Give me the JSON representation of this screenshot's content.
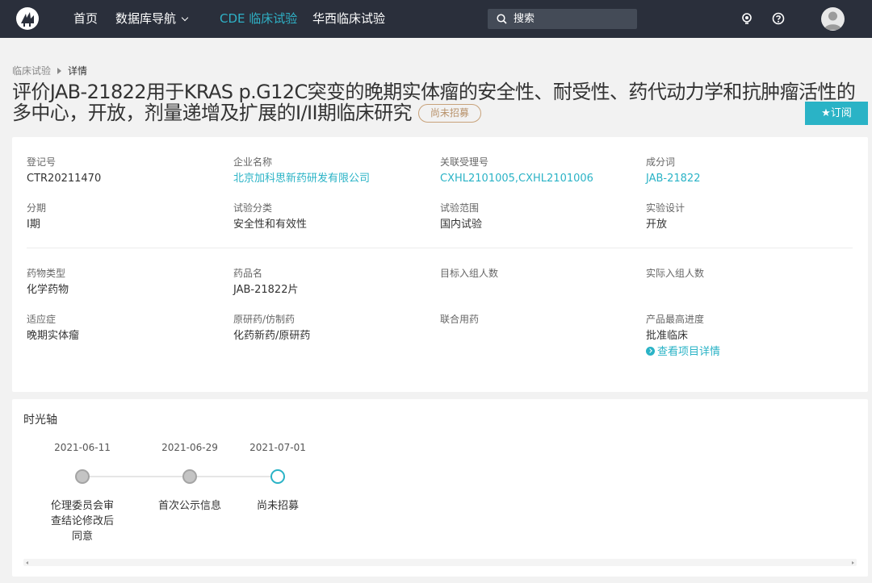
{
  "nav": {
    "logo_icon": "tree-logo-icon",
    "items": [
      {
        "label": "首页"
      },
      {
        "label": "数据库导航"
      },
      {
        "label": "CDE 临床试验"
      },
      {
        "label": "华西临床试验"
      }
    ],
    "search_placeholder": "搜索",
    "icons": [
      "theme-icon",
      "help-icon",
      "avatar-icon"
    ],
    "active_color": "#2fb1c6"
  },
  "breadcrumb": {
    "parent": "临床试验",
    "current": "详情"
  },
  "page": {
    "title": "评价JAB-21822用于KRAS p.G12C突变的晚期实体瘤的安全性、耐受性、药代动力学和抗肿瘤活性的多中心，开放，剂量递增及扩展的I/II期临床研究",
    "status": "尚未招募",
    "subscribe_label": "★订阅"
  },
  "info": {
    "reg_no": {
      "label": "登记号",
      "value": "CTR20211470"
    },
    "company": {
      "label": "企业名称",
      "value": "北京加科思新药研发有限公司"
    },
    "acceptance_no": {
      "label": "关联受理号",
      "value": "CXHL2101005,CXHL2101006"
    },
    "ingredient": {
      "label": "成分词",
      "value": "JAB-21822"
    },
    "phase": {
      "label": "分期",
      "value": "I期"
    },
    "trial_category": {
      "label": "试验分类",
      "value": "安全性和有效性"
    },
    "trial_scope": {
      "label": "试验范围",
      "value": "国内试验"
    },
    "design": {
      "label": "实验设计",
      "value": "开放"
    },
    "drug_type": {
      "label": "药物类型",
      "value": "化学药物"
    },
    "drug_name": {
      "label": "药品名",
      "value": "JAB-21822片"
    },
    "target_enroll": {
      "label": "目标入组人数",
      "value": ""
    },
    "actual_enroll": {
      "label": "实际入组人数",
      "value": ""
    },
    "indication": {
      "label": "适应症",
      "value": "晚期实体瘤"
    },
    "original_generic": {
      "label": "原研药/仿制药",
      "value": "化药新药/原研药"
    },
    "combination": {
      "label": "联合用药",
      "value": ""
    },
    "max_progress": {
      "label": "产品最高进度",
      "value": "批准临床"
    },
    "view_project_link": "查看项目详情"
  },
  "timeline": {
    "title": "时光轴",
    "events": [
      {
        "date": "2021-06-11",
        "label": "伦理委员会审查结论修改后同意"
      },
      {
        "date": "2021-06-29",
        "label": "首次公示信息"
      },
      {
        "date": "2021-07-01",
        "label": "尚未招募",
        "current": true
      }
    ]
  }
}
